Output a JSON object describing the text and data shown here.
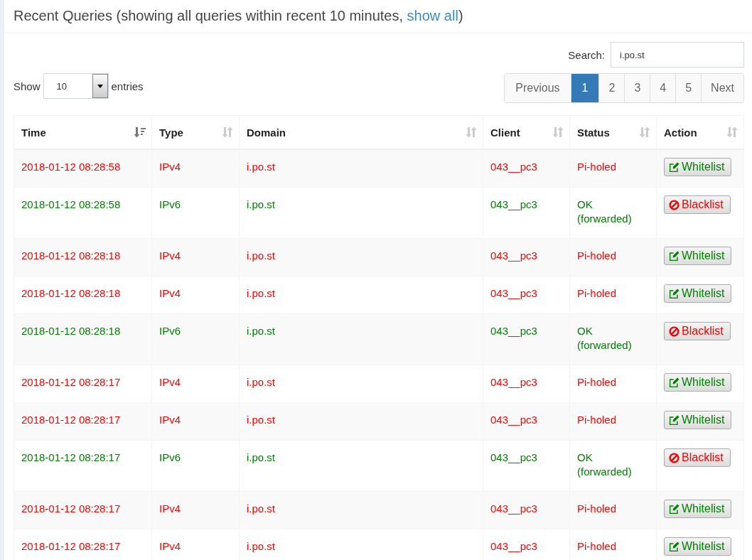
{
  "header": {
    "title": "Recent Queries (showing all queries within recent 10 minutes, ",
    "link": "show all",
    "title_end": ")"
  },
  "search": {
    "label": "Search:",
    "value": "i.po.st"
  },
  "length": {
    "label_before": "Show",
    "value": "10",
    "label_after": "entries"
  },
  "pagination": [
    {
      "label": "Previous",
      "selected": false
    },
    {
      "label": "1",
      "selected": true
    },
    {
      "label": "2",
      "selected": false
    },
    {
      "label": "3",
      "selected": false
    },
    {
      "label": "4",
      "selected": false
    },
    {
      "label": "5",
      "selected": false
    },
    {
      "label": "Next",
      "selected": false
    }
  ],
  "table": {
    "columns": [
      {
        "label": "Time",
        "sorted": true
      },
      {
        "label": "Type",
        "sorted": false
      },
      {
        "label": "Domain",
        "sorted": false
      },
      {
        "label": "Client",
        "sorted": false
      },
      {
        "label": "Status",
        "sorted": false
      },
      {
        "label": "Action",
        "sorted": false
      }
    ],
    "rows": [
      {
        "kind": "blocked",
        "time": "2018-01-12 08:28:58",
        "type": "IPv4",
        "domain": "i.po.st",
        "client": "043__pc3",
        "status": [
          "Pi-holed"
        ],
        "action": "Whitelist"
      },
      {
        "kind": "allowed",
        "time": "2018-01-12 08:28:58",
        "type": "IPv6",
        "domain": "i.po.st",
        "client": "043__pc3",
        "status": [
          "OK",
          "(forwarded)"
        ],
        "action": "Blacklist"
      },
      {
        "kind": "blocked",
        "time": "2018-01-12 08:28:18",
        "type": "IPv4",
        "domain": "i.po.st",
        "client": "043__pc3",
        "status": [
          "Pi-holed"
        ],
        "action": "Whitelist"
      },
      {
        "kind": "blocked",
        "time": "2018-01-12 08:28:18",
        "type": "IPv4",
        "domain": "i.po.st",
        "client": "043__pc3",
        "status": [
          "Pi-holed"
        ],
        "action": "Whitelist"
      },
      {
        "kind": "allowed",
        "time": "2018-01-12 08:28:18",
        "type": "IPv6",
        "domain": "i.po.st",
        "client": "043__pc3",
        "status": [
          "OK",
          "(forwarded)"
        ],
        "action": "Blacklist"
      },
      {
        "kind": "blocked",
        "time": "2018-01-12 08:28:17",
        "type": "IPv4",
        "domain": "i.po.st",
        "client": "043__pc3",
        "status": [
          "Pi-holed"
        ],
        "action": "Whitelist"
      },
      {
        "kind": "blocked",
        "time": "2018-01-12 08:28:17",
        "type": "IPv4",
        "domain": "i.po.st",
        "client": "043__pc3",
        "status": [
          "Pi-holed"
        ],
        "action": "Whitelist"
      },
      {
        "kind": "allowed",
        "time": "2018-01-12 08:28:17",
        "type": "IPv6",
        "domain": "i.po.st",
        "client": "043__pc3",
        "status": [
          "OK",
          "(forwarded)"
        ],
        "action": "Blacklist"
      },
      {
        "kind": "blocked",
        "time": "2018-01-12 08:28:17",
        "type": "IPv4",
        "domain": "i.po.st",
        "client": "043__pc3",
        "status": [
          "Pi-holed"
        ],
        "action": "Whitelist"
      },
      {
        "kind": "blocked",
        "time": "2018-01-12 08:28:17",
        "type": "IPv4",
        "domain": "i.po.st",
        "client": "043__pc3",
        "status": [
          "Pi-holed"
        ],
        "action": "Whitelist"
      }
    ]
  }
}
